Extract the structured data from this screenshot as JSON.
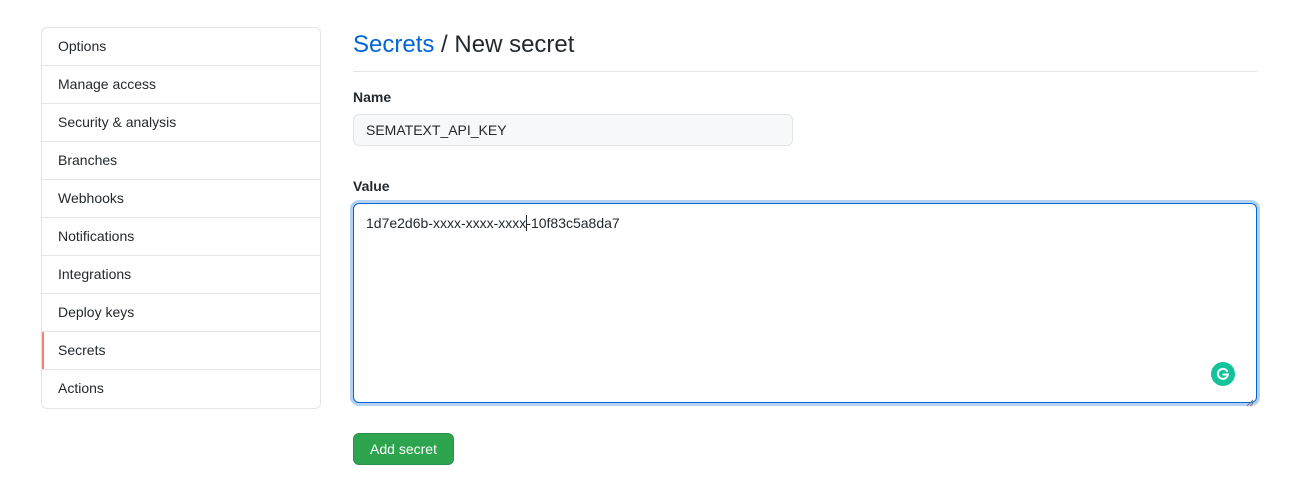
{
  "sidebar": {
    "items": [
      {
        "label": "Options"
      },
      {
        "label": "Manage access"
      },
      {
        "label": "Security & analysis"
      },
      {
        "label": "Branches"
      },
      {
        "label": "Webhooks"
      },
      {
        "label": "Notifications"
      },
      {
        "label": "Integrations"
      },
      {
        "label": "Deploy keys"
      },
      {
        "label": "Secrets",
        "selected": true
      },
      {
        "label": "Actions"
      }
    ]
  },
  "header": {
    "breadcrumb_link": "Secrets",
    "separator": " / ",
    "current": "New secret"
  },
  "form": {
    "name_label": "Name",
    "name_value": "SEMATEXT_API_KEY",
    "value_label": "Value",
    "value_before_caret": "1d7e2d6b-xxxx-xxxx-xxxx",
    "value_after_caret": "-10f83c5a8da7",
    "submit_label": "Add secret"
  },
  "colors": {
    "link": "#0366d6",
    "selected_indicator": "#f9826c",
    "primary_button": "#2ea44f",
    "focus_border": "#0366d6",
    "grammar_icon": "#15c39a"
  },
  "icons": {
    "grammar_assistant": "grammarly-icon",
    "resize": "resize-grip-icon"
  }
}
